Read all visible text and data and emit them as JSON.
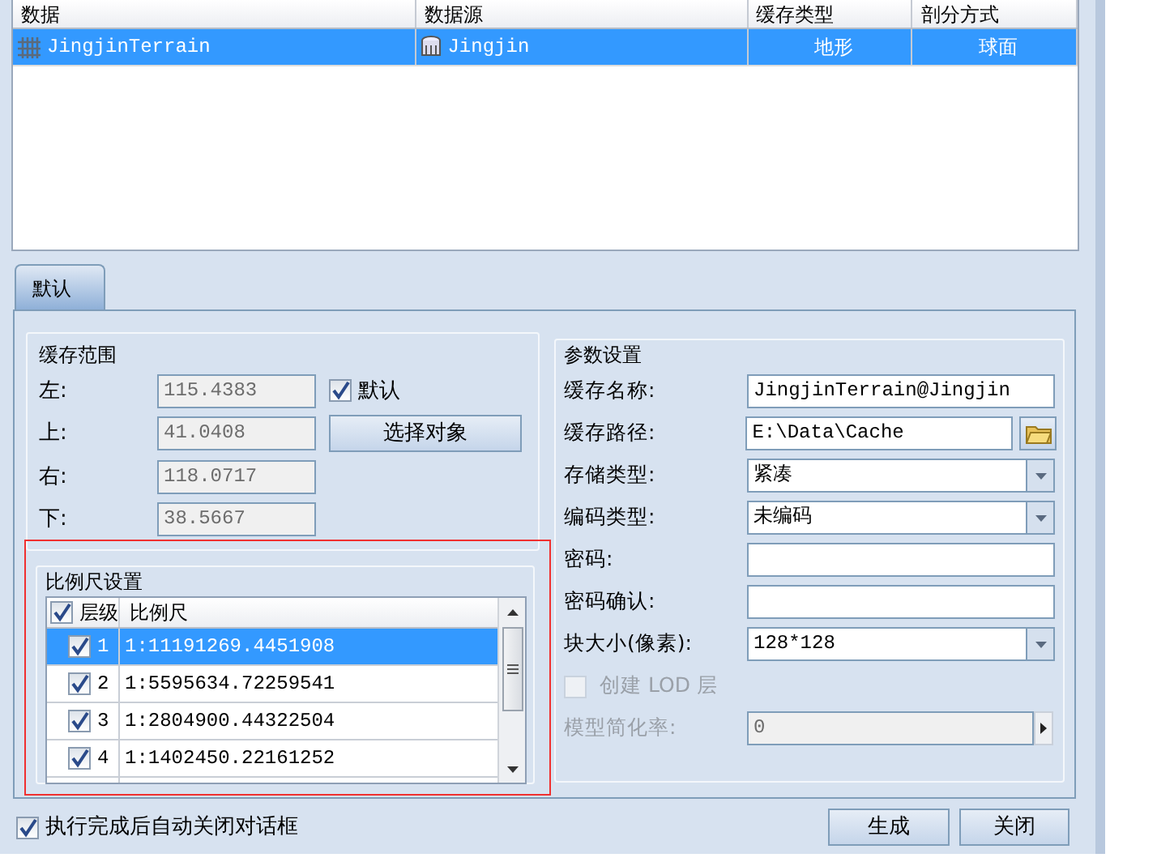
{
  "table": {
    "columns": [
      "数据",
      "数据源",
      "缓存类型",
      "剖分方式"
    ],
    "rows": [
      {
        "cells": [
          "JingjinTerrain",
          "Jingjin",
          "地形",
          "球面"
        ],
        "selected": true
      }
    ]
  },
  "tabs": [
    {
      "label": "默认",
      "selected": true
    }
  ],
  "extent": {
    "title": "缓存范围",
    "fields": [
      {
        "label": "左:",
        "value": "115.4383"
      },
      {
        "label": "上:",
        "value": "41.0408"
      },
      {
        "label": "右:",
        "value": "118.0717"
      },
      {
        "label": "下:",
        "value": "38.5667"
      }
    ],
    "default_checkbox": {
      "label": "默认",
      "checked": true
    },
    "select_button": "选择对象"
  },
  "scales": {
    "title": "比例尺设置",
    "header": {
      "level": "层级",
      "scale": "比例尺",
      "checked": true
    },
    "rows": [
      {
        "level": "1",
        "scale": "1:11191269.4451908",
        "checked": true,
        "selected": true
      },
      {
        "level": "2",
        "scale": "1:5595634.72259541",
        "checked": true,
        "selected": false
      },
      {
        "level": "3",
        "scale": "1:2804900.44322504",
        "checked": true,
        "selected": false
      },
      {
        "level": "4",
        "scale": "1:1402450.22161252",
        "checked": true,
        "selected": false
      }
    ]
  },
  "params": {
    "title": "参数设置",
    "rows": [
      {
        "kind": "text",
        "label": "缓存名称:",
        "value": "JingjinTerrain@Jingjin"
      },
      {
        "kind": "path",
        "label": "缓存路径:",
        "value": "E:\\Data\\Cache"
      },
      {
        "kind": "select",
        "label": "存储类型:",
        "value": "紧凑"
      },
      {
        "kind": "select",
        "label": "编码类型:",
        "value": "未编码"
      },
      {
        "kind": "text",
        "label": "密码:"
      },
      {
        "kind": "text",
        "label": "密码确认:"
      },
      {
        "kind": "select",
        "label": "块大小(像素):",
        "value": "128*128"
      },
      {
        "kind": "checkbox",
        "label": "创建 LOD 层",
        "checked": false,
        "disabled": true
      },
      {
        "kind": "spin",
        "label": "模型简化率:",
        "value": "0",
        "disabled": true
      }
    ]
  },
  "auto_close": {
    "label": "执行完成后自动关闭对话框",
    "checked": true
  },
  "buttons": [
    "生成",
    "关闭"
  ]
}
